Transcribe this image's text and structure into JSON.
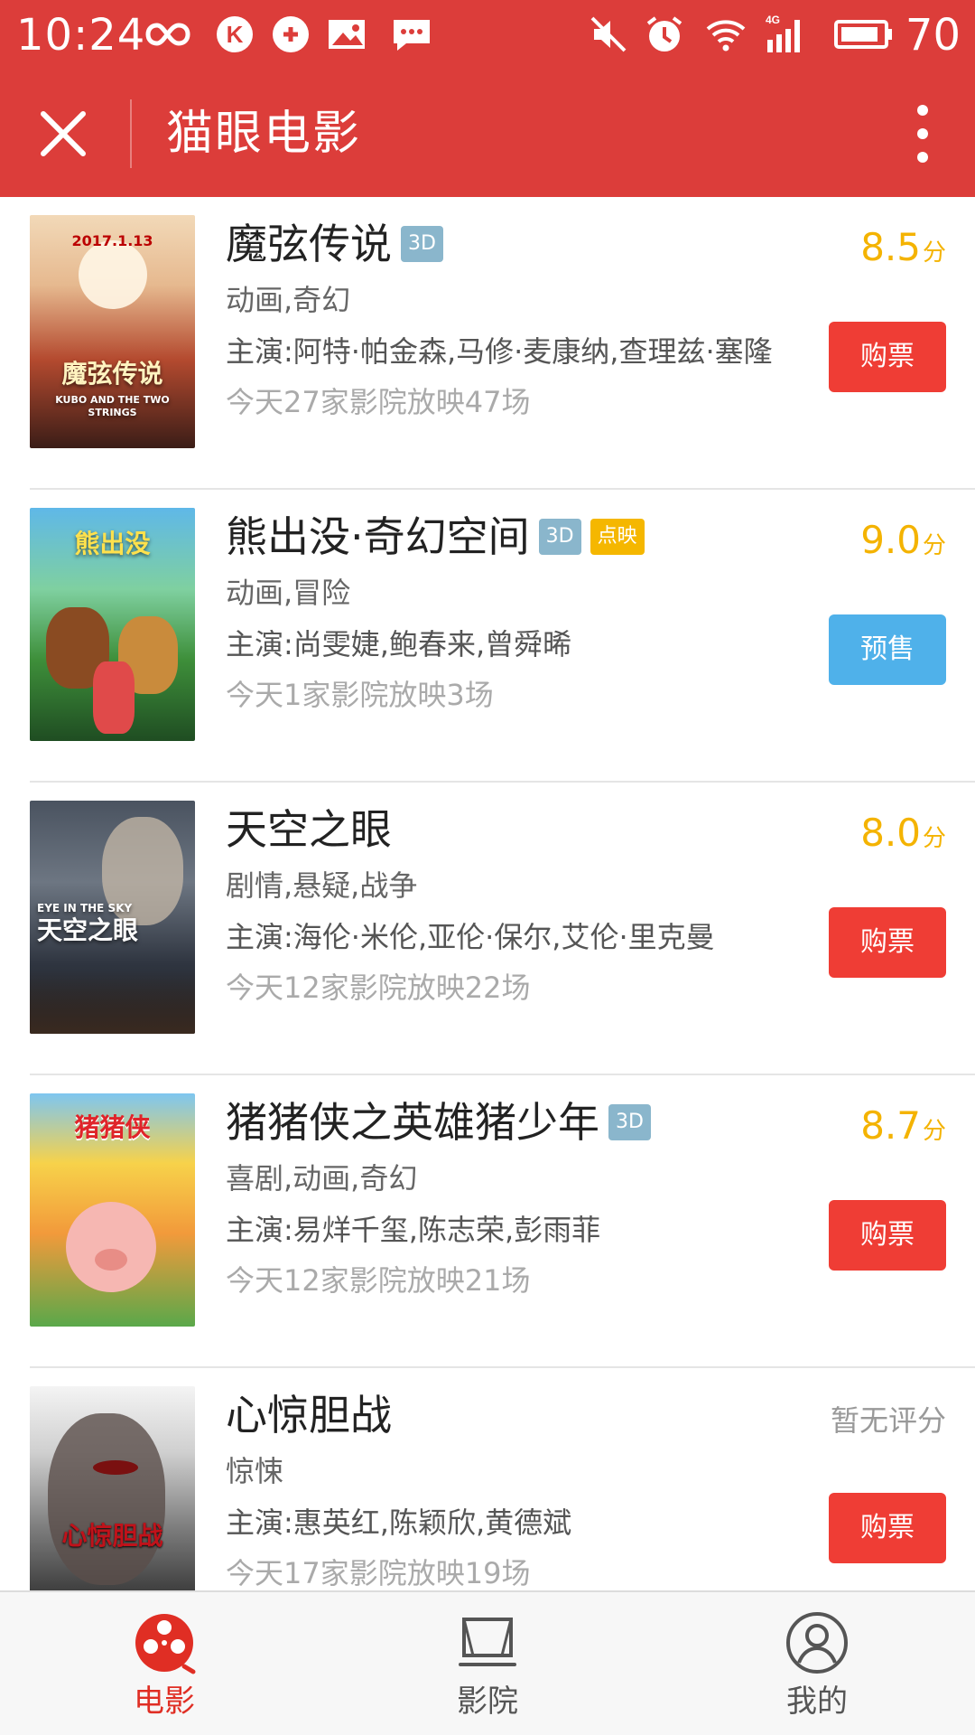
{
  "status_bar": {
    "time": "10:24",
    "battery": "70",
    "network": "4G"
  },
  "header": {
    "title": "猫眼电影"
  },
  "movies": [
    {
      "title": "魔弦传说",
      "tags": [
        "3D"
      ],
      "genre": "动画,奇幻",
      "actors": "主演:阿特·帕金森,马修·麦康纳,查理兹·塞隆",
      "showtimes": "今天27家影院放映47场",
      "score": "8.5",
      "score_unit": "分",
      "action": "购票",
      "poster_date": "2017.1.13",
      "poster_title": "魔弦传说",
      "poster_sub": "KUBO AND THE TWO STRINGS"
    },
    {
      "title": "熊出没·奇幻空间",
      "tags": [
        "3D",
        "点映"
      ],
      "genre": "动画,冒险",
      "actors": "主演:尚雯婕,鲍春来,曾舜晞",
      "showtimes": "今天1家影院放映3场",
      "score": "9.0",
      "score_unit": "分",
      "action": "预售",
      "poster_title": "熊出没"
    },
    {
      "title": "天空之眼",
      "tags": [],
      "genre": "剧情,悬疑,战争",
      "actors": "主演:海伦·米伦,亚伦·保尔,艾伦·里克曼",
      "showtimes": "今天12家影院放映22场",
      "score": "8.0",
      "score_unit": "分",
      "action": "购票",
      "poster_en": "EYE IN THE SKY",
      "poster_title": "天空之眼"
    },
    {
      "title": "猪猪侠之英雄猪少年",
      "tags": [
        "3D"
      ],
      "genre": "喜剧,动画,奇幻",
      "actors": "主演:易烊千玺,陈志荣,彭雨菲",
      "showtimes": "今天12家影院放映21场",
      "score": "8.7",
      "score_unit": "分",
      "action": "购票",
      "poster_title": "猪猪侠"
    },
    {
      "title": "心惊胆战",
      "tags": [],
      "genre": "惊悚",
      "actors": "主演:惠英红,陈颖欣,黄德斌",
      "showtimes": "今天17家影院放映19场",
      "score_text": "暂无评分",
      "action": "购票",
      "poster_title": "心惊胆战"
    }
  ],
  "tabs": [
    {
      "label": "电影",
      "icon": "film-reel-icon",
      "active": true
    },
    {
      "label": "影院",
      "icon": "cinema-screen-icon",
      "active": false
    },
    {
      "label": "我的",
      "icon": "profile-icon",
      "active": false
    }
  ],
  "colors": {
    "brand_red": "#dc3d3a",
    "score_yellow": "#f4b300",
    "buy_red": "#ef3d35",
    "presale_blue": "#4fb1ea",
    "tag_3d": "#8ab6cc",
    "tag_preview": "#f5b700"
  }
}
